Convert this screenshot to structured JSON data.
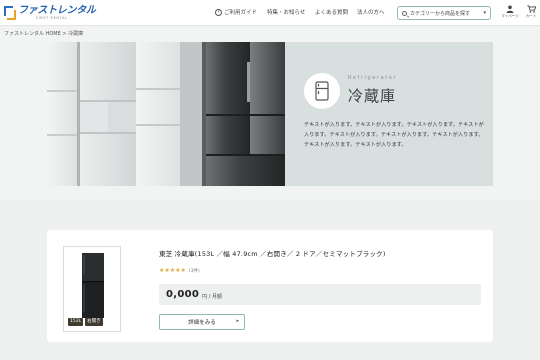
{
  "header": {
    "logo_main": "ファストレンタル",
    "logo_sub": "FIRST RENTAL",
    "nav": [
      "ご利用ガイド",
      "特集・お知らせ",
      "よくある質問",
      "法人の方へ"
    ],
    "search_placeholder": "カテゴリーから商品を探す",
    "mypage_label": "マイページ",
    "cart_label": "カート"
  },
  "breadcrumb": "ファストレンタル HOME > 冷蔵庫",
  "hero": {
    "category_en": "Refrigerator",
    "category_title": "冷蔵庫",
    "description": "テキストが入ります。テキストが入ります。テキストが入ります。テキストが入ります。テキストが入ります。テキストが入ります。テキストが入ります。テキストが入ります。テキストが入ります。"
  },
  "product": {
    "title": "東芝 冷蔵庫(153L ／幅 47.9cm ／右開き／ 2 ドア／セミマットブラック)",
    "stars": "★★★★★",
    "rating": 5,
    "review_count": "(3件)",
    "price": "0,000",
    "price_unit": "円 / 月額",
    "badge_capacity": "153L",
    "badge_door": "右開き",
    "detail_button": "詳細をみる"
  },
  "colors": {
    "accent": "#8fb8b5",
    "logo_blue": "#2563b3",
    "logo_orange": "#e7a326",
    "hero_bg": "#d7dfdf",
    "star": "#e1a93a"
  }
}
